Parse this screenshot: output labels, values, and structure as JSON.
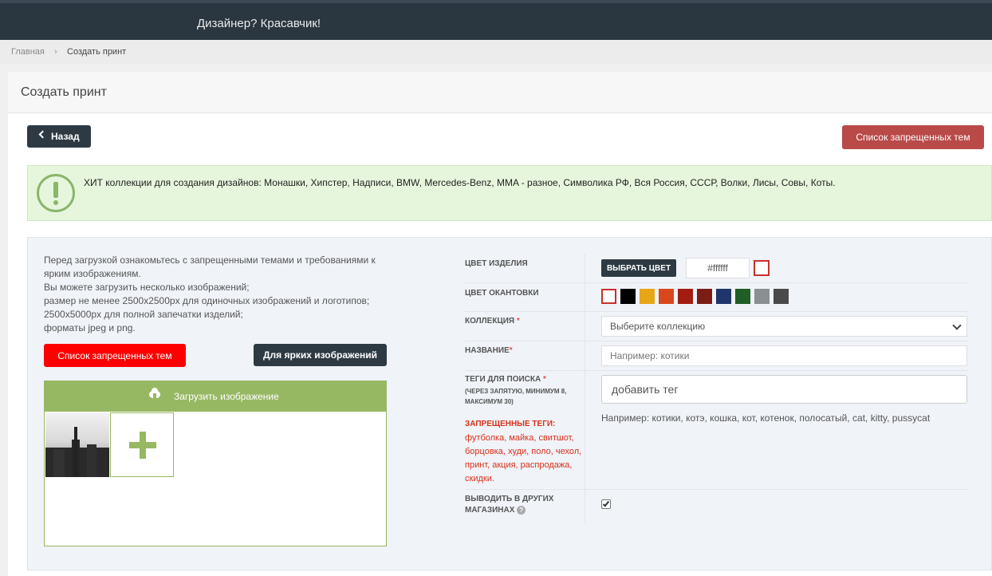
{
  "header": {
    "brand": "Дизайнер? Красавчик!"
  },
  "breadcrumb": {
    "home": "Главная",
    "current": "Создать принт"
  },
  "page": {
    "title": "Создать принт"
  },
  "toolbar": {
    "back_label": "Назад",
    "forbidden_topics_label": "Список запрещенных тем"
  },
  "alert": {
    "text": "ХИТ коллекции для создания дизайнов: Монашки, Хипстер, Надписи, BMW, Mercedes-Benz, MMA - разное, Символика РФ, Вся Россия, СССР, Волки, Лисы, Совы, Коты."
  },
  "upload_section": {
    "rules": [
      "Перед загрузкой ознакомьтесь с запрещенными темами и требованиями к ярким изображениям.",
      "Вы можете загрузить несколько изображений;",
      "размер не менее 2500x2500px для одиночных изображений и логотипов;",
      "2500x5000px для полной запечатки изделий;",
      "форматы jpeg и png."
    ],
    "forbidden_btn": "Список запрещенных тем",
    "bright_btn": "Для ярких изображений",
    "upload_label": "Загрузить изображение"
  },
  "form": {
    "product_color": {
      "label": "Цвет изделия",
      "button": "ВЫБРАТЬ ЦВЕТ",
      "value": "#ffffff"
    },
    "edge_color": {
      "label": "Цвет окантовки",
      "swatches": [
        "#ffffff",
        "#000000",
        "#e8a617",
        "#d9481c",
        "#a31c12",
        "#7a1d14",
        "#1f356b",
        "#1f5e25",
        "#8a8f94",
        "#4a4a4a"
      ]
    },
    "collection": {
      "label": "Коллекция",
      "req": "*",
      "placeholder": "Выберите коллекцию"
    },
    "name": {
      "label": "Название",
      "req": "*",
      "placeholder": "Например: котики"
    },
    "tags": {
      "label": "Теги для поиска",
      "req": "*",
      "sublabel": "(через запятую, минимум 8, максимум 30)",
      "placeholder": "добавить тег",
      "help": "Например: котики, котэ, кошка, кот, котенок, полосатый, cat, kitty, pussycat",
      "forbidden_title": "ЗАПРЕЩЕННЫЕ ТЕГИ:",
      "forbidden_list": "футболка, майка, свитшот, борцовка, худи, поло, чехол, принт, акция, распродажа, скидки."
    },
    "other_shops": {
      "label": "Выводить в других магазинах",
      "help": "?",
      "checked": true
    }
  }
}
